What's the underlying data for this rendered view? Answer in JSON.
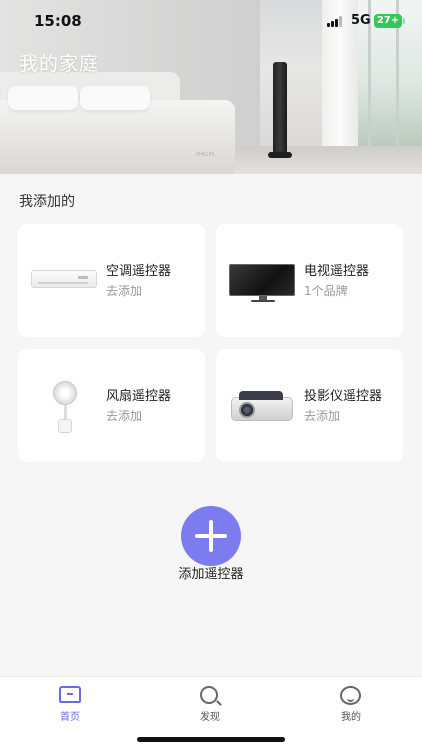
{
  "status_bar": {
    "time": "15:08",
    "network": "5G",
    "battery": "27+"
  },
  "hero": {
    "title": "我的家庭",
    "watermark": "PHILIPS"
  },
  "section": {
    "title": "我添加的"
  },
  "devices": [
    {
      "name": "空调遥控器",
      "subtitle": "去添加",
      "icon": "air-conditioner"
    },
    {
      "name": "电视遥控器",
      "subtitle": "1个品牌",
      "icon": "television"
    },
    {
      "name": "风扇遥控器",
      "subtitle": "去添加",
      "icon": "fan"
    },
    {
      "name": "投影仪遥控器",
      "subtitle": "去添加",
      "icon": "projector"
    }
  ],
  "add": {
    "label": "添加遥控器"
  },
  "tabbar": {
    "tabs": [
      {
        "label": "首页",
        "icon": "home-icon",
        "active": true
      },
      {
        "label": "发现",
        "icon": "search-icon",
        "active": false
      },
      {
        "label": "我的",
        "icon": "smile-icon",
        "active": false
      }
    ]
  },
  "colors": {
    "accent": "#7c7bef",
    "background": "#f6f6f7",
    "card": "#ffffff",
    "battery": "#34c759"
  }
}
